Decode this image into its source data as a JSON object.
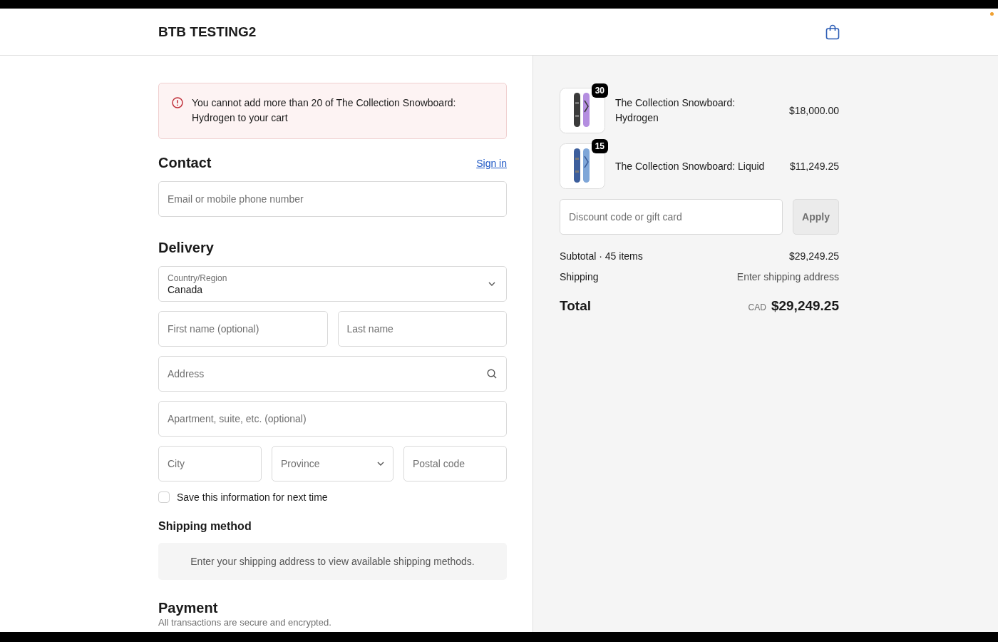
{
  "header": {
    "store_name": "BTB TESTING2"
  },
  "alert": {
    "message": "You cannot add more than 20 of The Collection Snowboard: Hydrogen to your cart"
  },
  "contact": {
    "heading": "Contact",
    "sign_in_link": "Sign in",
    "email_field": {
      "placeholder": "Email or mobile phone number"
    }
  },
  "delivery": {
    "heading": "Delivery",
    "country": {
      "label": "Country/Region",
      "value": "Canada"
    },
    "rows": [
      {
        "fields": [
          {
            "kind": "text",
            "placeholder": "First name (optional)"
          },
          {
            "kind": "text",
            "placeholder": "Last name"
          }
        ]
      },
      {
        "fields": [
          {
            "kind": "search",
            "placeholder": "Address"
          }
        ]
      },
      {
        "fields": [
          {
            "kind": "text",
            "placeholder": "Apartment, suite, etc. (optional)"
          }
        ]
      },
      {
        "fields": [
          {
            "kind": "text",
            "placeholder": "City"
          },
          {
            "kind": "select",
            "placeholder": "Province"
          },
          {
            "kind": "text",
            "placeholder": "Postal code"
          }
        ]
      }
    ],
    "save_info": {
      "label": "Save this information for next time",
      "checked": false
    }
  },
  "shipping_method": {
    "heading": "Shipping method",
    "notice": "Enter your shipping address to view available shipping methods."
  },
  "payment": {
    "heading": "Payment",
    "subtitle": "All transactions are secure and encrypted."
  },
  "summary": {
    "items": [
      {
        "quantity": "30",
        "name": "The Collection Snowboard: Hydrogen",
        "price": "$18,000.00"
      },
      {
        "quantity": "15",
        "name": "The Collection Snowboard: Liquid",
        "price": "$11,249.25"
      }
    ],
    "discount_field": {
      "placeholder": "Discount code or gift card"
    },
    "apply_button": "Apply",
    "subtotal_label": "Subtotal · 45 items",
    "subtotal_value": "$29,249.25",
    "shipping_label": "Shipping",
    "shipping_value": "Enter shipping address",
    "total_label": "Total",
    "currency": "CAD",
    "total_value": "$29,249.25"
  }
}
